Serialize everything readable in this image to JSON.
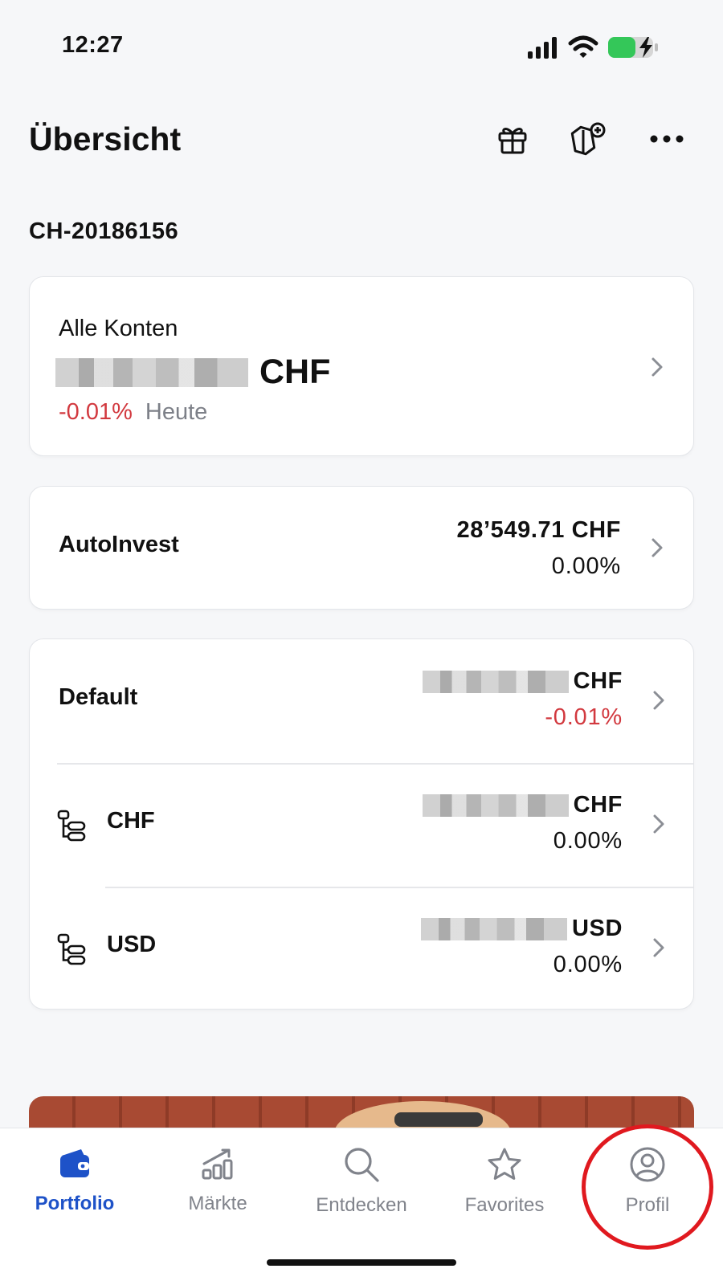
{
  "status_bar": {
    "time": "12:27"
  },
  "header": {
    "title": "Übersicht",
    "icons": [
      "gift-icon",
      "tag-plus-icon",
      "more-icon"
    ]
  },
  "account_id": "CH-20186156",
  "all_accounts": {
    "label": "Alle Konten",
    "currency": "CHF",
    "change": "-0.01%",
    "period": "Heute"
  },
  "autoinvest": {
    "name": "AutoInvest",
    "value": "28’549.71 CHF",
    "change": "0.00%"
  },
  "default_group": {
    "name": "Default",
    "currency": "CHF",
    "change": "-0.01%",
    "accounts": [
      {
        "name": "CHF",
        "currency": "CHF",
        "change": "0.00%"
      },
      {
        "name": "USD",
        "currency": "USD",
        "change": "0.00%"
      }
    ]
  },
  "tabs": [
    {
      "label": "Portfolio",
      "icon": "wallet-icon",
      "active": true
    },
    {
      "label": "Märkte",
      "icon": "chart-growth-icon",
      "active": false
    },
    {
      "label": "Entdecken",
      "icon": "search-icon",
      "active": false
    },
    {
      "label": "Favorites",
      "icon": "star-icon",
      "active": false
    },
    {
      "label": "Profil",
      "icon": "user-circle-icon",
      "active": false
    }
  ],
  "colors": {
    "accent": "#1e52c8",
    "negative": "#d2393f",
    "highlight": "#e0191f"
  }
}
